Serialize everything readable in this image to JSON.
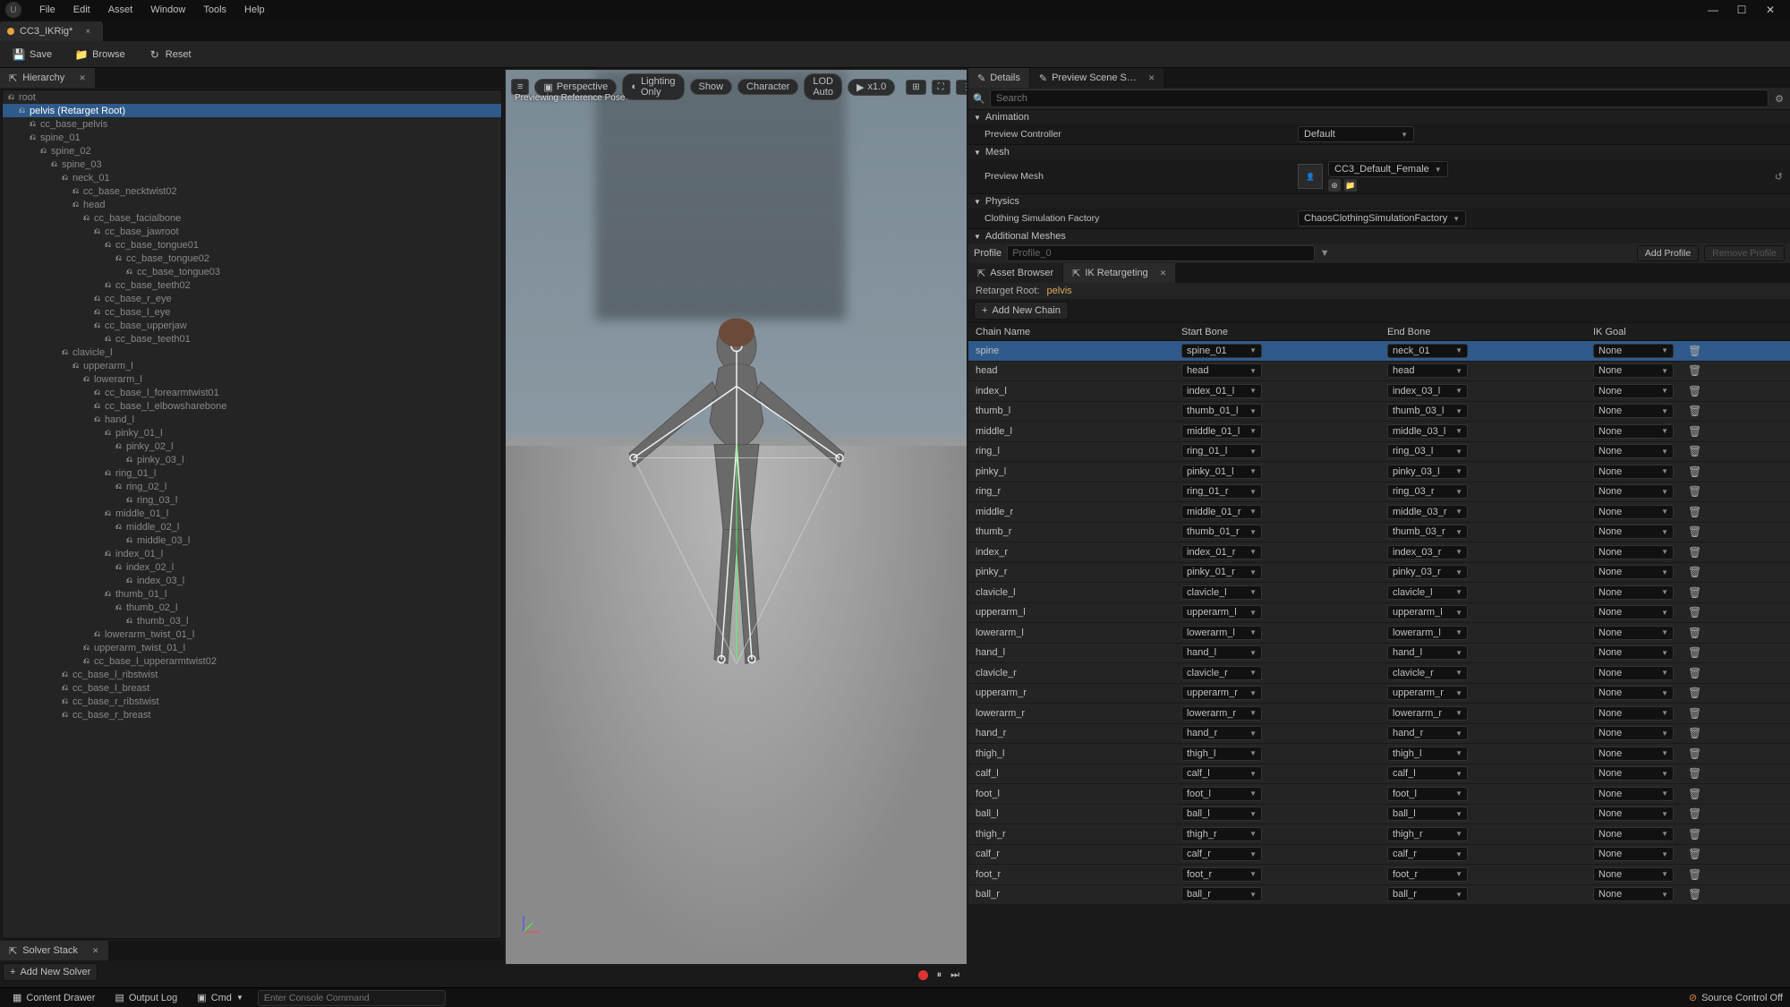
{
  "menus": [
    "File",
    "Edit",
    "Asset",
    "Window",
    "Tools",
    "Help"
  ],
  "doc_tab": {
    "name": "CC3_IKRig*",
    "close": "×"
  },
  "toolbar": {
    "save": "Save",
    "browse": "Browse",
    "reset": "Reset"
  },
  "hierarchy": {
    "title": "Hierarchy",
    "retarget_root_suffix": "(Retarget Root)",
    "nodes": [
      {
        "n": "root",
        "d": 0
      },
      {
        "n": "pelvis",
        "d": 1,
        "suffix": true,
        "sel": true
      },
      {
        "n": "cc_base_pelvis",
        "d": 2
      },
      {
        "n": "spine_01",
        "d": 2
      },
      {
        "n": "spine_02",
        "d": 3
      },
      {
        "n": "spine_03",
        "d": 4
      },
      {
        "n": "neck_01",
        "d": 5
      },
      {
        "n": "cc_base_necktwist02",
        "d": 6
      },
      {
        "n": "head",
        "d": 6
      },
      {
        "n": "cc_base_facialbone",
        "d": 7
      },
      {
        "n": "cc_base_jawroot",
        "d": 8
      },
      {
        "n": "cc_base_tongue01",
        "d": 9
      },
      {
        "n": "cc_base_tongue02",
        "d": 10
      },
      {
        "n": "cc_base_tongue03",
        "d": 11
      },
      {
        "n": "cc_base_teeth02",
        "d": 9
      },
      {
        "n": "cc_base_r_eye",
        "d": 8
      },
      {
        "n": "cc_base_l_eye",
        "d": 8
      },
      {
        "n": "cc_base_upperjaw",
        "d": 8
      },
      {
        "n": "cc_base_teeth01",
        "d": 9
      },
      {
        "n": "clavicle_l",
        "d": 5
      },
      {
        "n": "upperarm_l",
        "d": 6
      },
      {
        "n": "lowerarm_l",
        "d": 7
      },
      {
        "n": "cc_base_l_forearmtwist01",
        "d": 8
      },
      {
        "n": "cc_base_l_elbowsharebone",
        "d": 8
      },
      {
        "n": "hand_l",
        "d": 8
      },
      {
        "n": "pinky_01_l",
        "d": 9
      },
      {
        "n": "pinky_02_l",
        "d": 10
      },
      {
        "n": "pinky_03_l",
        "d": 11
      },
      {
        "n": "ring_01_l",
        "d": 9
      },
      {
        "n": "ring_02_l",
        "d": 10
      },
      {
        "n": "ring_03_l",
        "d": 11
      },
      {
        "n": "middle_01_l",
        "d": 9
      },
      {
        "n": "middle_02_l",
        "d": 10
      },
      {
        "n": "middle_03_l",
        "d": 11
      },
      {
        "n": "index_01_l",
        "d": 9
      },
      {
        "n": "index_02_l",
        "d": 10
      },
      {
        "n": "index_03_l",
        "d": 11
      },
      {
        "n": "thumb_01_l",
        "d": 9
      },
      {
        "n": "thumb_02_l",
        "d": 10
      },
      {
        "n": "thumb_03_l",
        "d": 11
      },
      {
        "n": "lowerarm_twist_01_l",
        "d": 8
      },
      {
        "n": "upperarm_twist_01_l",
        "d": 7
      },
      {
        "n": "cc_base_l_upperarmtwist02",
        "d": 7
      },
      {
        "n": "cc_base_l_ribstwist",
        "d": 5
      },
      {
        "n": "cc_base_l_breast",
        "d": 5
      },
      {
        "n": "cc_base_r_ribstwist",
        "d": 5
      },
      {
        "n": "cc_base_r_breast",
        "d": 5
      }
    ]
  },
  "solver": {
    "title": "Solver Stack",
    "add": "Add New Solver"
  },
  "viewport": {
    "menu": "≡",
    "perspective": "Perspective",
    "lighting": "Lighting Only",
    "show": "Show",
    "character": "Character",
    "lod": "LOD Auto",
    "speed": "x1.0",
    "caption": "Previewing Reference Pose"
  },
  "details": {
    "tab1": "Details",
    "tab2": "Preview Scene S…",
    "search_ph": "Search",
    "animation": {
      "h": "Animation",
      "preview_controller": "Preview Controller",
      "pc_val": "Default"
    },
    "mesh": {
      "h": "Mesh",
      "preview_mesh": "Preview Mesh",
      "pm_val": "CC3_Default_Female"
    },
    "physics": {
      "h": "Physics",
      "csf": "Clothing Simulation Factory",
      "csf_val": "ChaosClothingSimulationFactory"
    },
    "addmesh": {
      "h": "Additional Meshes"
    }
  },
  "profile": {
    "lbl": "Profile",
    "ph": "Profile_0",
    "add": "Add Profile",
    "remove": "Remove Profile"
  },
  "browser": {
    "tab1": "Asset Browser",
    "tab2": "IK Retargeting"
  },
  "retarget": {
    "root_lbl": "Retarget Root:",
    "root_val": "pelvis",
    "add_chain": "Add New Chain",
    "cols": {
      "name": "Chain Name",
      "start": "Start Bone",
      "end": "End Bone",
      "goal": "IK Goal"
    },
    "none": "None",
    "rows": [
      {
        "n": "spine",
        "s": "spine_01",
        "e": "neck_01",
        "sel": true
      },
      {
        "n": "head",
        "s": "head",
        "e": "head"
      },
      {
        "n": "index_l",
        "s": "index_01_l",
        "e": "index_03_l"
      },
      {
        "n": "thumb_l",
        "s": "thumb_01_l",
        "e": "thumb_03_l"
      },
      {
        "n": "middle_l",
        "s": "middle_01_l",
        "e": "middle_03_l"
      },
      {
        "n": "ring_l",
        "s": "ring_01_l",
        "e": "ring_03_l"
      },
      {
        "n": "pinky_l",
        "s": "pinky_01_l",
        "e": "pinky_03_l"
      },
      {
        "n": "ring_r",
        "s": "ring_01_r",
        "e": "ring_03_r"
      },
      {
        "n": "middle_r",
        "s": "middle_01_r",
        "e": "middle_03_r"
      },
      {
        "n": "thumb_r",
        "s": "thumb_01_r",
        "e": "thumb_03_r"
      },
      {
        "n": "index_r",
        "s": "index_01_r",
        "e": "index_03_r"
      },
      {
        "n": "pinky_r",
        "s": "pinky_01_r",
        "e": "pinky_03_r"
      },
      {
        "n": "clavicle_l",
        "s": "clavicle_l",
        "e": "clavicle_l"
      },
      {
        "n": "upperarm_l",
        "s": "upperarm_l",
        "e": "upperarm_l"
      },
      {
        "n": "lowerarm_l",
        "s": "lowerarm_l",
        "e": "lowerarm_l"
      },
      {
        "n": "hand_l",
        "s": "hand_l",
        "e": "hand_l"
      },
      {
        "n": "clavicle_r",
        "s": "clavicle_r",
        "e": "clavicle_r"
      },
      {
        "n": "upperarm_r",
        "s": "upperarm_r",
        "e": "upperarm_r"
      },
      {
        "n": "lowerarm_r",
        "s": "lowerarm_r",
        "e": "lowerarm_r"
      },
      {
        "n": "hand_r",
        "s": "hand_r",
        "e": "hand_r"
      },
      {
        "n": "thigh_l",
        "s": "thigh_l",
        "e": "thigh_l"
      },
      {
        "n": "calf_l",
        "s": "calf_l",
        "e": "calf_l"
      },
      {
        "n": "foot_l",
        "s": "foot_l",
        "e": "foot_l"
      },
      {
        "n": "ball_l",
        "s": "ball_l",
        "e": "ball_l"
      },
      {
        "n": "thigh_r",
        "s": "thigh_r",
        "e": "thigh_r"
      },
      {
        "n": "calf_r",
        "s": "calf_r",
        "e": "calf_r"
      },
      {
        "n": "foot_r",
        "s": "foot_r",
        "e": "foot_r"
      },
      {
        "n": "ball_r",
        "s": "ball_r",
        "e": "ball_r"
      }
    ]
  },
  "status": {
    "drawer": "Content Drawer",
    "output": "Output Log",
    "cmd": "Cmd",
    "console_ph": "Enter Console Command",
    "src": "Source Control Off"
  }
}
